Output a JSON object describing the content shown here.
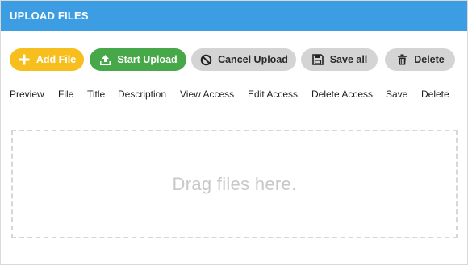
{
  "panel": {
    "title": "UPLOAD FILES"
  },
  "toolbar": {
    "add_file_label": "Add File",
    "add_file_icon": "plus-icon",
    "start_upload_label": "Start Upload",
    "start_upload_icon": "upload-icon",
    "cancel_upload_label": "Cancel Upload",
    "cancel_upload_icon": "cancel-icon",
    "save_all_label": "Save all",
    "save_all_icon": "floppy-disk-icon",
    "delete_label": "Delete",
    "delete_icon": "trash-icon"
  },
  "columns": [
    "Preview",
    "File",
    "Title",
    "Description",
    "View Access",
    "Edit Access",
    "Delete Access",
    "Save",
    "Delete"
  ],
  "dropzone": {
    "hint": "Drag files here."
  },
  "colors": {
    "header": "#3d9de3",
    "add_button": "#f7bf1e",
    "start_button": "#47a84a",
    "neutral_button": "#d4d4d4"
  }
}
